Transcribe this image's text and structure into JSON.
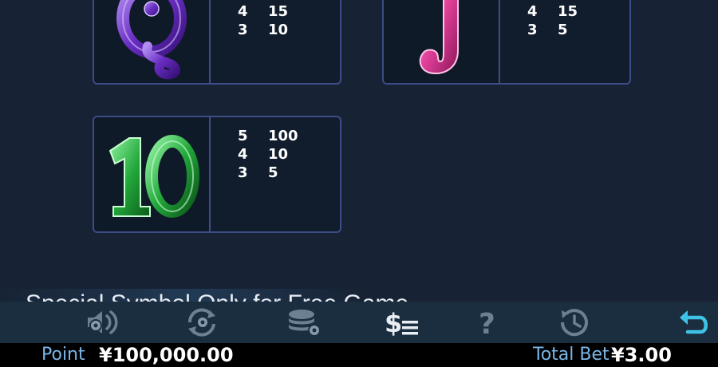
{
  "paytable": [
    {
      "symbol": "Q",
      "pays": [
        {
          "count": "4",
          "amount": "15"
        },
        {
          "count": "3",
          "amount": "10"
        }
      ]
    },
    {
      "symbol": "J",
      "pays": [
        {
          "count": "4",
          "amount": "15"
        },
        {
          "count": "3",
          "amount": "5"
        }
      ]
    },
    {
      "symbol": "10",
      "pays": [
        {
          "count": "5",
          "amount": "100"
        },
        {
          "count": "4",
          "amount": "10"
        },
        {
          "count": "3",
          "amount": "5"
        }
      ]
    }
  ],
  "special_heading": "Special Symbol Only for Free Game",
  "toolbar": {
    "icons": [
      "sound-icon",
      "autoplay-icon",
      "chips-settings-icon",
      "paytable-icon",
      "help-icon",
      "history-icon",
      "back-icon"
    ]
  },
  "footer": {
    "point_label": "Point",
    "point_value": "¥100,000.00",
    "total_bet_label": "Total Bet",
    "total_bet_value": "¥3.00"
  },
  "colors": {
    "background": "#172335",
    "card_border": "#3d4c86",
    "accent_blue": "#7ab6e8",
    "back_icon": "#3ec3e6",
    "q_symbol": "#6a2ec4",
    "j_symbol": "#e0409a",
    "ten_symbol": "#22a83a"
  }
}
